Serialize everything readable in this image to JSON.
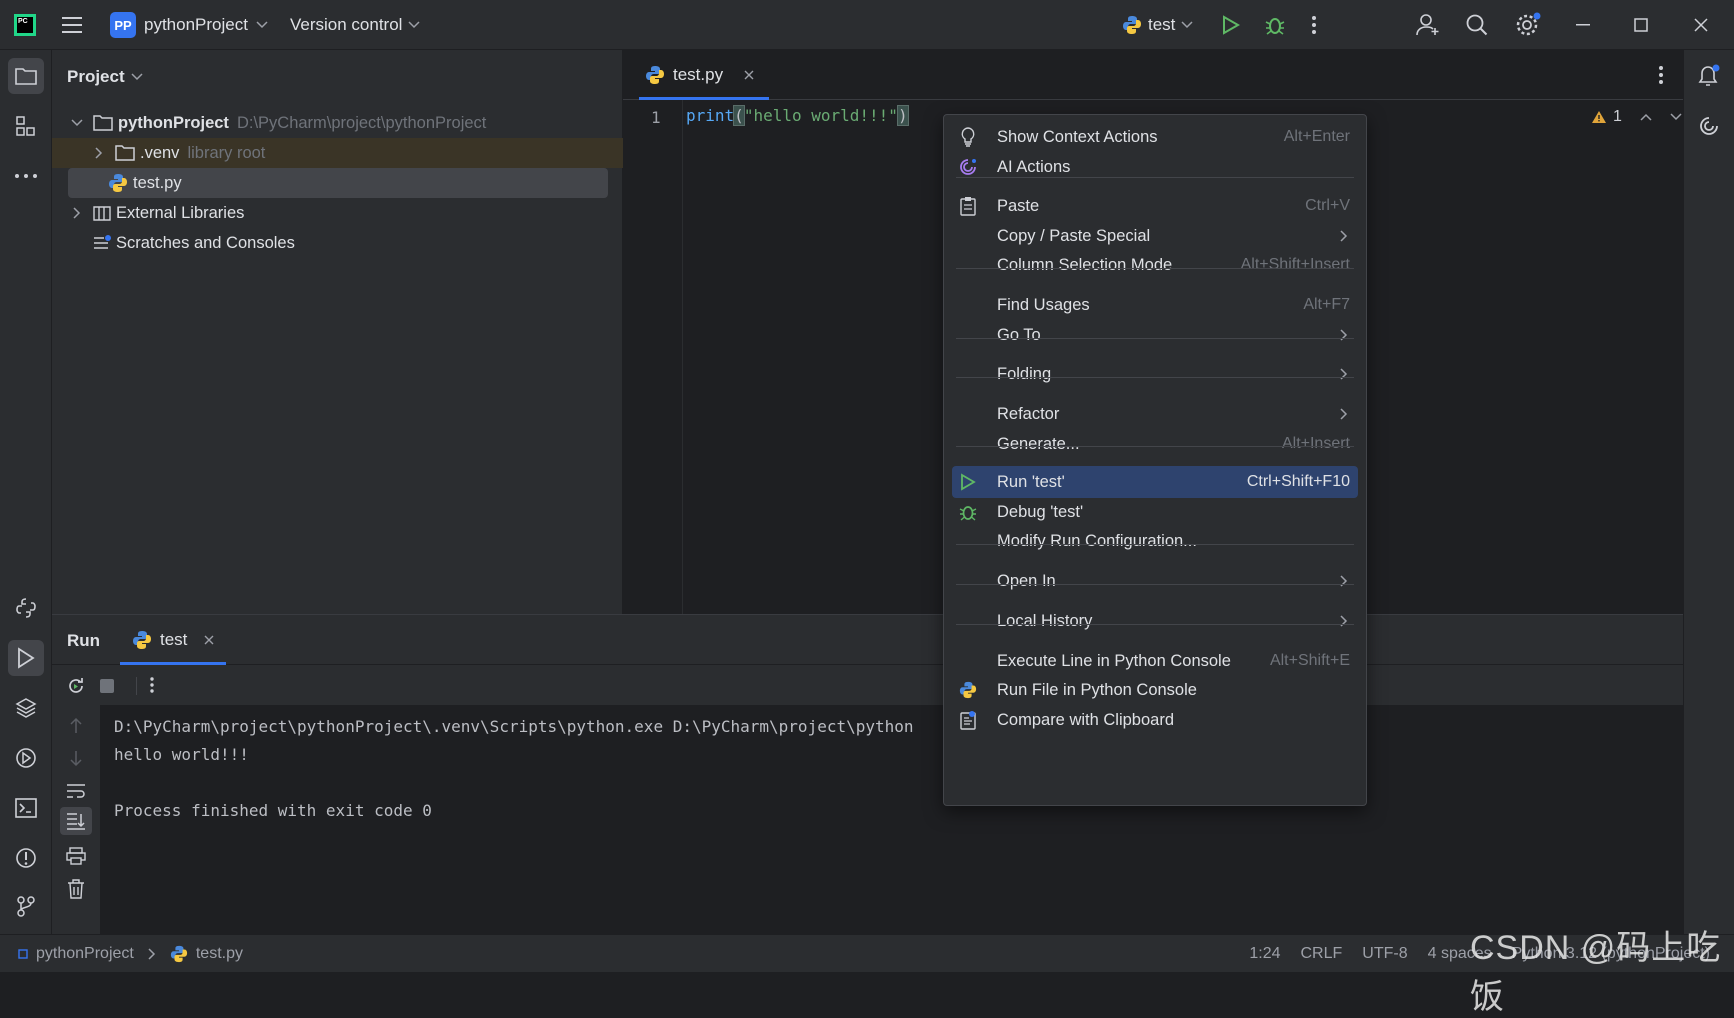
{
  "titlebar": {
    "project_badge": "PP",
    "project_name": "pythonProject",
    "version_control": "Version control",
    "run_config": "test"
  },
  "project_panel": {
    "title": "Project",
    "tree": [
      {
        "label": "pythonProject",
        "path": "D:\\PyCharm\\project\\pythonProject"
      },
      {
        "label": ".venv",
        "hint": "library root"
      },
      {
        "label": "test.py"
      },
      {
        "label": "External Libraries"
      },
      {
        "label": "Scratches and Consoles"
      }
    ]
  },
  "editor": {
    "tab_label": "test.py",
    "line_number": "1",
    "code": {
      "fn": "print",
      "open": "(",
      "str": "\"hello world!!!\"",
      "close": ")"
    },
    "warning_count": "1"
  },
  "run_panel": {
    "title": "Run",
    "tab_label": "test",
    "console_lines": [
      "D:\\PyCharm\\project\\pythonProject\\.venv\\Scripts\\python.exe D:\\PyCharm\\project\\python",
      "hello world!!!",
      "",
      "Process finished with exit code 0"
    ]
  },
  "context_menu": {
    "items": [
      {
        "label": "Show Context Actions",
        "shortcut": "Alt+Enter",
        "icon": "bulb-icon"
      },
      {
        "label": "AI Actions",
        "shortcut": "",
        "icon": "ai-icon"
      },
      {
        "label": "Paste",
        "shortcut": "Ctrl+V",
        "icon": "clipboard-icon"
      },
      {
        "label": "Copy / Paste Special",
        "shortcut": "",
        "submenu": true
      },
      {
        "label": "Column Selection Mode",
        "shortcut": "Alt+Shift+Insert"
      },
      {
        "label": "Find Usages",
        "shortcut": "Alt+F7"
      },
      {
        "label": "Go To",
        "shortcut": "",
        "submenu": true
      },
      {
        "label": "Folding",
        "shortcut": "",
        "submenu": true
      },
      {
        "label": "Refactor",
        "shortcut": "",
        "submenu": true
      },
      {
        "label": "Generate...",
        "shortcut": "Alt+Insert"
      },
      {
        "label": "Run 'test'",
        "shortcut": "Ctrl+Shift+F10",
        "icon": "run-icon",
        "highlighted": true
      },
      {
        "label": "Debug 'test'",
        "shortcut": "",
        "icon": "debug-icon"
      },
      {
        "label": "Modify Run Configuration...",
        "shortcut": ""
      },
      {
        "label": "Open In",
        "shortcut": "",
        "submenu": true
      },
      {
        "label": "Local History",
        "shortcut": "",
        "submenu": true
      },
      {
        "label": "Execute Line in Python Console",
        "shortcut": "Alt+Shift+E"
      },
      {
        "label": "Run File in Python Console",
        "shortcut": "",
        "icon": "python-icon"
      },
      {
        "label": "Compare with Clipboard",
        "shortcut": "",
        "icon": "compare-icon"
      }
    ]
  },
  "statusbar": {
    "crumb_project": "pythonProject",
    "crumb_file": "test.py",
    "position": "1:24",
    "line_sep": "CRLF",
    "encoding": "UTF-8",
    "indent": "4 spaces",
    "interpreter": "Python 3.12 (pythonProject)"
  },
  "watermark": "CSDN @码上吃饭",
  "colors": {
    "accent": "#3574f0",
    "run_green": "#5fb865",
    "menu_highlight": "#2e436e"
  }
}
